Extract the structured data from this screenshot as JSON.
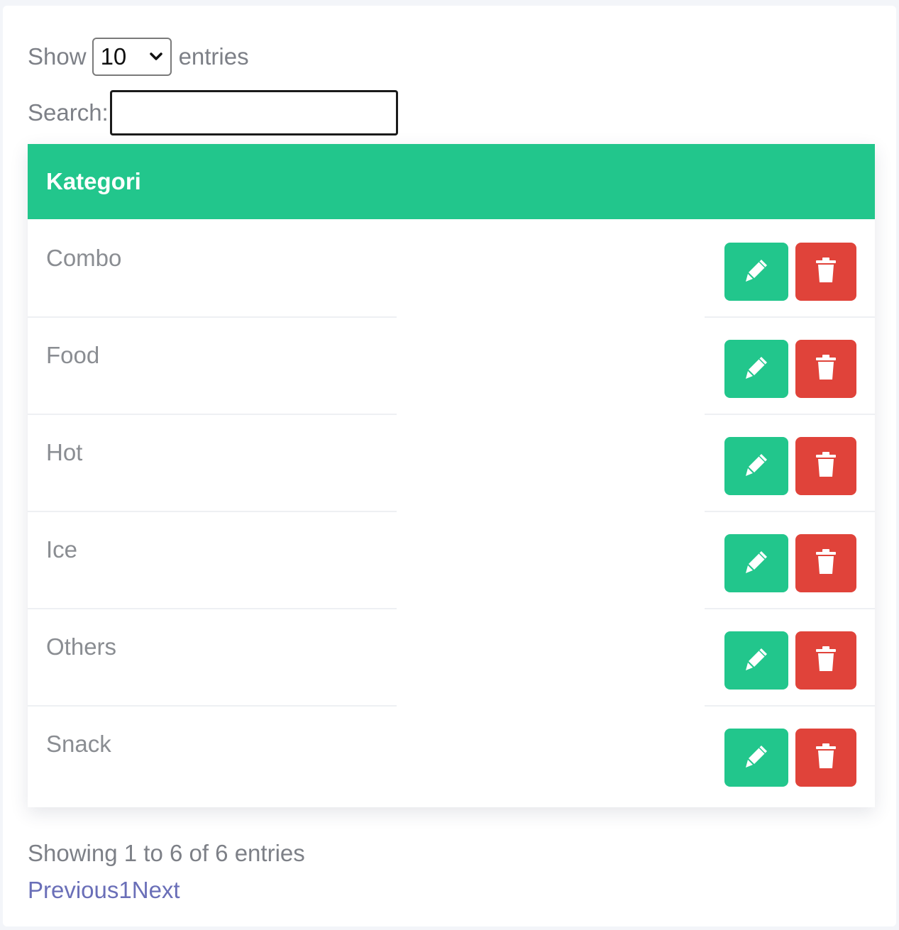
{
  "length_menu": {
    "prefix": "Show",
    "selected": "10",
    "suffix": "entries"
  },
  "search": {
    "label": "Search:",
    "value": ""
  },
  "table": {
    "header": "Kategori",
    "rows": [
      {
        "label": "Combo"
      },
      {
        "label": "Food"
      },
      {
        "label": "Hot"
      },
      {
        "label": "Ice"
      },
      {
        "label": "Others"
      },
      {
        "label": "Snack"
      }
    ],
    "edit_icon": "pencil-icon",
    "delete_icon": "trash-icon"
  },
  "info": "Showing 1 to 6 of 6 entries",
  "pagination": {
    "previous": "Previous",
    "page": "1",
    "next": "Next"
  },
  "colors": {
    "accent_green": "#22c68c",
    "danger_red": "#e0433a",
    "link": "#6a6fb8"
  }
}
